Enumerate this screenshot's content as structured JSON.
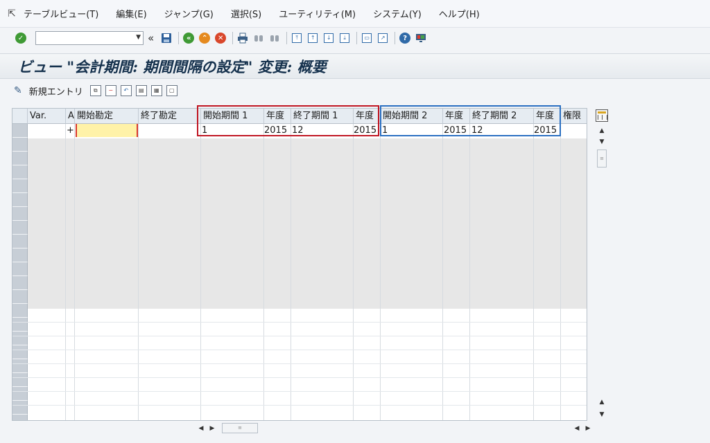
{
  "menu": {
    "items": [
      "テーブルビュー(T)",
      "編集(E)",
      "ジャンプ(G)",
      "選択(S)",
      "ユーティリティ(M)",
      "システム(Y)",
      "ヘルプ(H)"
    ]
  },
  "toolbar": {
    "command_value": ""
  },
  "title": "ビュー \"会計期間: 期間間隔の設定\" 変更: 概要",
  "app_toolbar": {
    "new_entries_label": "新規エントリ"
  },
  "table": {
    "headers": [
      "Var.",
      "A",
      "開始勘定",
      "終了勘定",
      "開始期間 1",
      "年度",
      "終了期間 1",
      "年度",
      "開始期間 2",
      "年度",
      "終了期間 2",
      "年度",
      "権限"
    ],
    "row1": {
      "a": "+",
      "from_acct": "",
      "to_acct": "",
      "from_period1": "1",
      "year1": "2015",
      "to_period1": "12",
      "year1b": "2015",
      "from_period2": "1",
      "year2": "2015",
      "to_period2": "12",
      "year2b": "2015"
    }
  },
  "colors": {
    "highlight_red": "#c01622",
    "highlight_blue": "#2a6fc1",
    "input_yellow": "#fff2a8"
  }
}
